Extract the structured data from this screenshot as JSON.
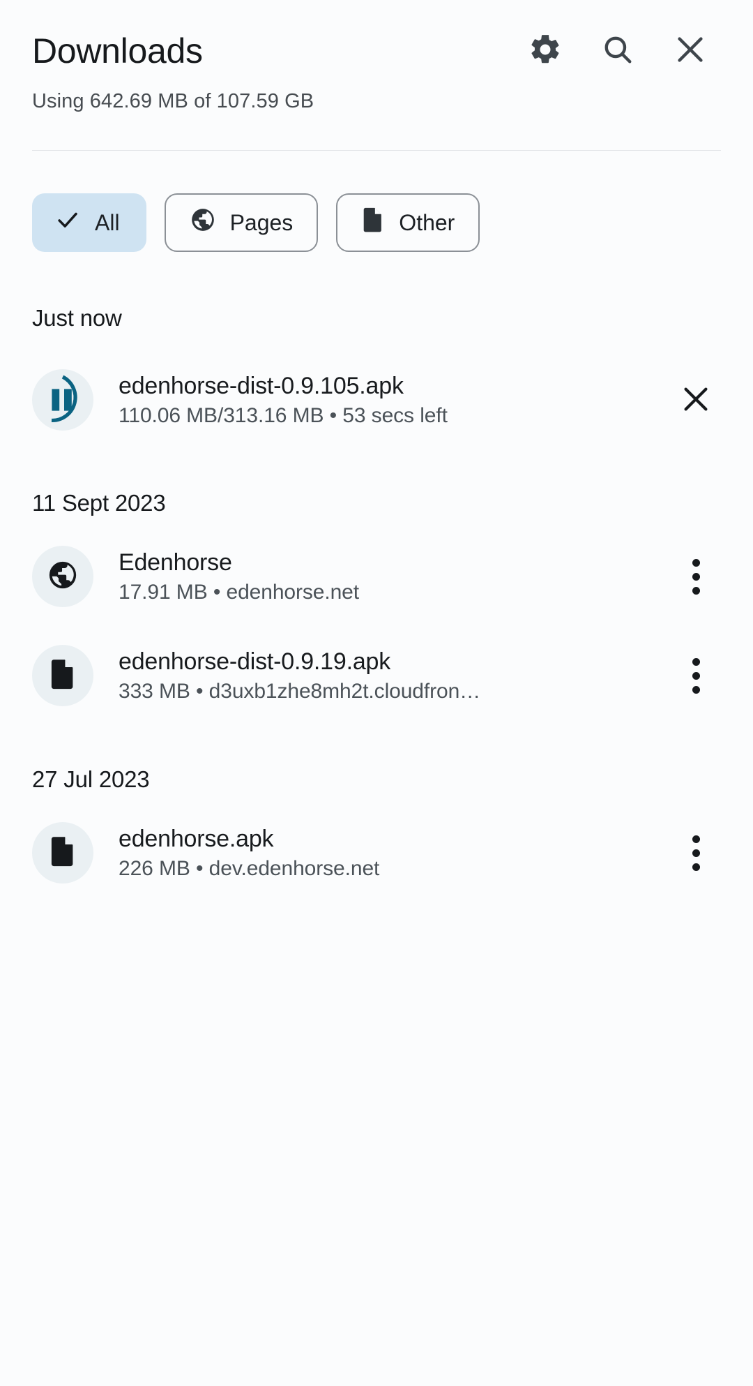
{
  "header": {
    "title": "Downloads",
    "actions": [
      {
        "name": "settings-icon",
        "label": "Settings"
      },
      {
        "name": "search-icon",
        "label": "Search"
      },
      {
        "name": "close-icon",
        "label": "Close"
      }
    ]
  },
  "storage": {
    "text": "Using 642.69 MB of 107.59 GB"
  },
  "filters": {
    "chips": [
      {
        "label": "All",
        "icon": "check-icon",
        "selected": true
      },
      {
        "label": "Pages",
        "icon": "globe-icon",
        "selected": false
      },
      {
        "label": "Other",
        "icon": "document-icon",
        "selected": false
      }
    ]
  },
  "sections": [
    {
      "title": "Just now",
      "items": [
        {
          "title": "edenhorse-dist-0.9.105.apk",
          "subtitle": "110.06 MB/313.16 MB • 53 secs left",
          "icon": "pause-icon",
          "action": "cancel-download-icon",
          "progress_percent": 57
        }
      ]
    },
    {
      "title": "11 Sept 2023",
      "items": [
        {
          "title": "Edenhorse",
          "subtitle": "17.91 MB • edenhorse.net",
          "icon": "globe-icon",
          "action": "more-options-icon"
        },
        {
          "title": "edenhorse-dist-0.9.19.apk",
          "subtitle": "333 MB • d3uxb1zhe8mh2t.cloudfron…",
          "icon": "document-icon",
          "action": "more-options-icon"
        }
      ]
    },
    {
      "title": "27 Jul 2023",
      "items": [
        {
          "title": "edenhorse.apk",
          "subtitle": "226 MB • dev.edenhorse.net",
          "icon": "document-icon",
          "action": "more-options-icon"
        }
      ]
    }
  ],
  "colors": {
    "background": "#fbfcfd",
    "text_primary": "#16191c",
    "text_secondary": "#4b5258",
    "chip_selected_bg": "#cfe3f2",
    "avatar_bg": "#eaf0f3",
    "progress_accent": "#0b6382",
    "icon_dark": "#3e454b"
  }
}
